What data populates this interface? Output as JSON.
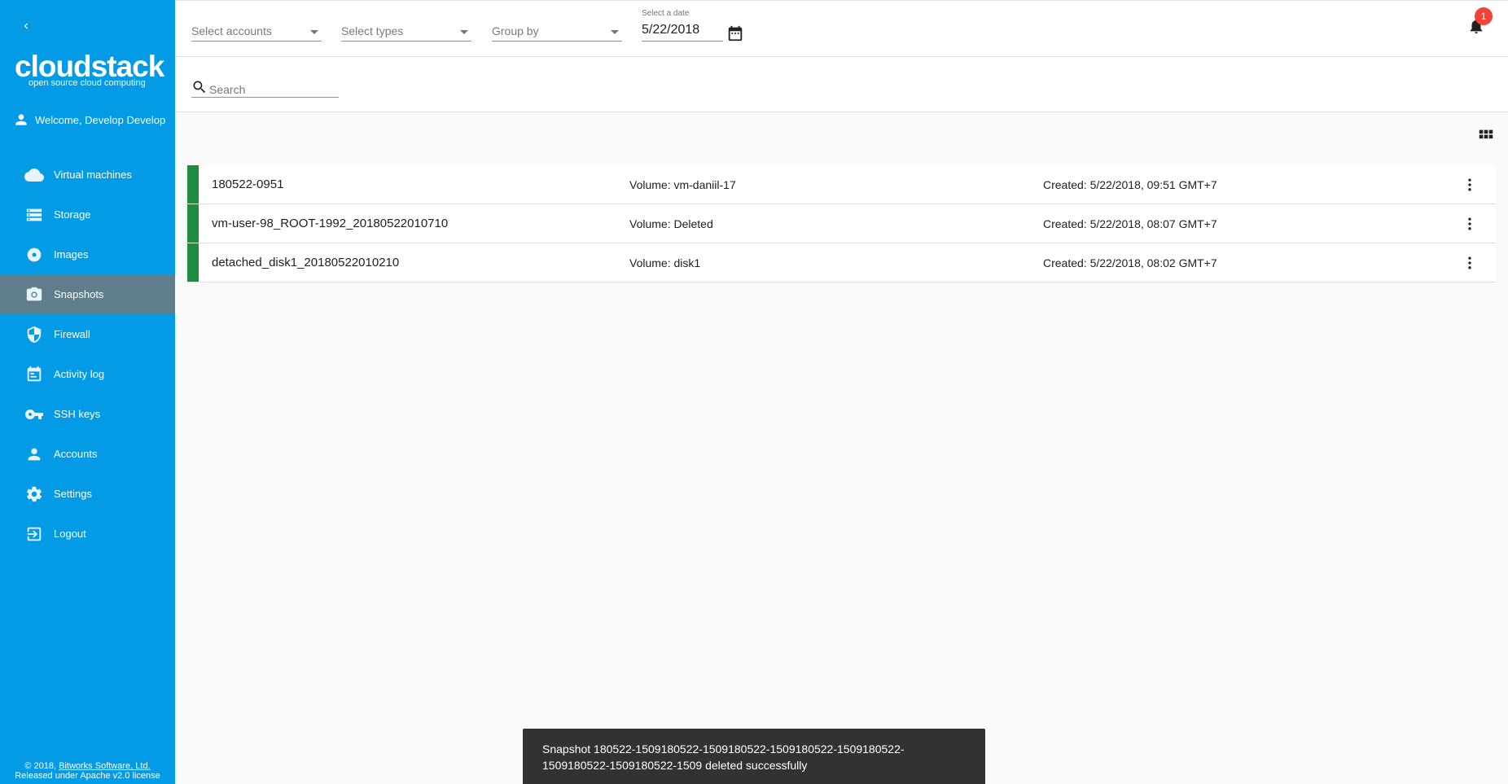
{
  "sidebar": {
    "logo_main": "cloudstack",
    "logo_sub": "open source cloud computing",
    "welcome": "Welcome, Develop Develop",
    "items": [
      {
        "label": "Virtual machines",
        "icon": "cloud-icon"
      },
      {
        "label": "Storage",
        "icon": "storage-icon"
      },
      {
        "label": "Images",
        "icon": "disc-icon"
      },
      {
        "label": "Snapshots",
        "icon": "camera-icon",
        "active": true
      },
      {
        "label": "Firewall",
        "icon": "shield-icon"
      },
      {
        "label": "Activity log",
        "icon": "calendar-icon"
      },
      {
        "label": "SSH keys",
        "icon": "key-icon"
      },
      {
        "label": "Accounts",
        "icon": "person-icon"
      },
      {
        "label": "Settings",
        "icon": "gear-icon"
      },
      {
        "label": "Logout",
        "icon": "logout-icon"
      }
    ],
    "footer_prefix": "© 2018, ",
    "footer_link": "Bitworks Software, Ltd.",
    "footer_line2": "Released under Apache v2.0 license"
  },
  "filters": {
    "accounts_placeholder": "Select accounts",
    "types_placeholder": "Select types",
    "group_placeholder": "Group by",
    "date_label": "Select a date",
    "date_value": "5/22/2018"
  },
  "notifications": {
    "count": "1"
  },
  "search": {
    "placeholder": "Search"
  },
  "snapshots": [
    {
      "name": "180522-0951",
      "volume": "Volume: vm-daniil-17",
      "created": "Created: 5/22/2018, 09:51 GMT+7"
    },
    {
      "name": "vm-user-98_ROOT-1992_20180522010710",
      "volume": "Volume: Deleted",
      "created": "Created: 5/22/2018, 08:07 GMT+7"
    },
    {
      "name": "detached_disk1_20180522010210",
      "volume": "Volume: disk1",
      "created": "Created: 5/22/2018, 08:02 GMT+7"
    }
  ],
  "snackbar": {
    "message": "Snapshot 180522-1509180522-1509180522-1509180522-1509180522-1509180522-1509180522-1509 deleted successfully"
  },
  "colors": {
    "sidebar": "#039be5",
    "active_item": "#607d8b",
    "state_ok": "#1e8e3e",
    "badge": "#f44336"
  }
}
